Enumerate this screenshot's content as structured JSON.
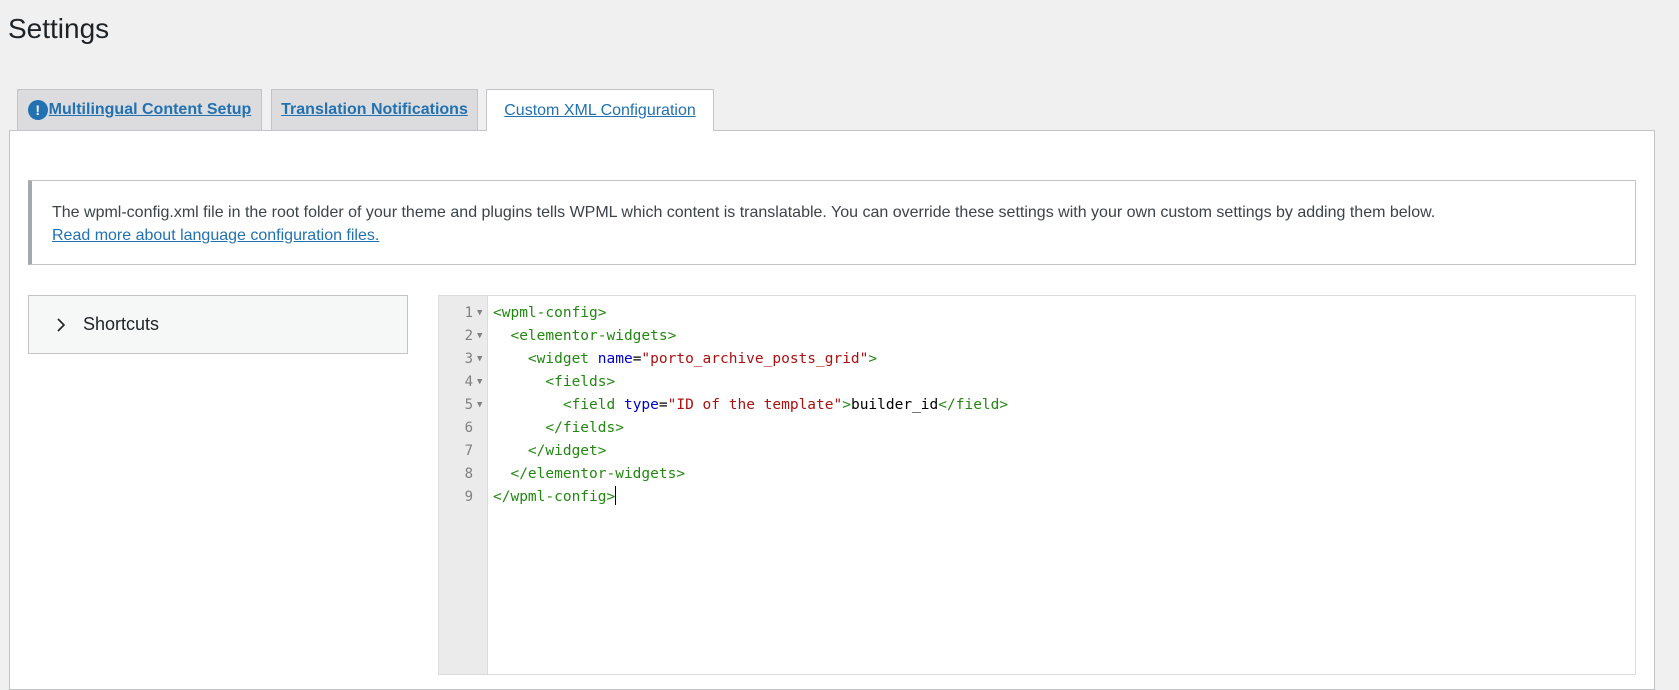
{
  "page_title": "Settings",
  "tabs": [
    {
      "label": "Multilingual Content Setup",
      "warning_icon": "!"
    },
    {
      "label": "Translation Notifications"
    },
    {
      "label": "Custom XML Configuration",
      "active": true
    }
  ],
  "notice": {
    "text": "The wpml-config.xml file in the root folder of your theme and plugins tells WPML which content is translatable. You can override these settings with your own custom settings by adding them below.",
    "link": "Read more about language configuration files."
  },
  "shortcuts": {
    "label": "Shortcuts",
    "icon": "chevron-right-icon"
  },
  "editor": {
    "line_numbers": [
      "1",
      "2",
      "3",
      "4",
      "5",
      "6",
      "7",
      "8",
      "9"
    ],
    "code": {
      "l1": "<wpml-config>",
      "l2": "<elementor-widgets>",
      "l3_open": "<widget",
      "l3_attr": "name",
      "l3_eq": "=",
      "l3_val": "\"porto_archive_posts_grid\"",
      "l3_close": ">",
      "l4": "<fields>",
      "l5_open": "<field",
      "l5_attr": "type",
      "l5_eq": "=",
      "l5_val": "\"ID of the template\"",
      "l5_gt": ">",
      "l5_text": "builder_id",
      "l5_close": "</field>",
      "l6": "</fields>",
      "l7": "</widget>",
      "l8": "</elementor-widgets>",
      "l9": "</wpml-config>"
    }
  },
  "colors": {
    "link": "#2271b1",
    "xml_tag": "#228811",
    "xml_attr": "#0000cc",
    "xml_string": "#aa1111"
  }
}
